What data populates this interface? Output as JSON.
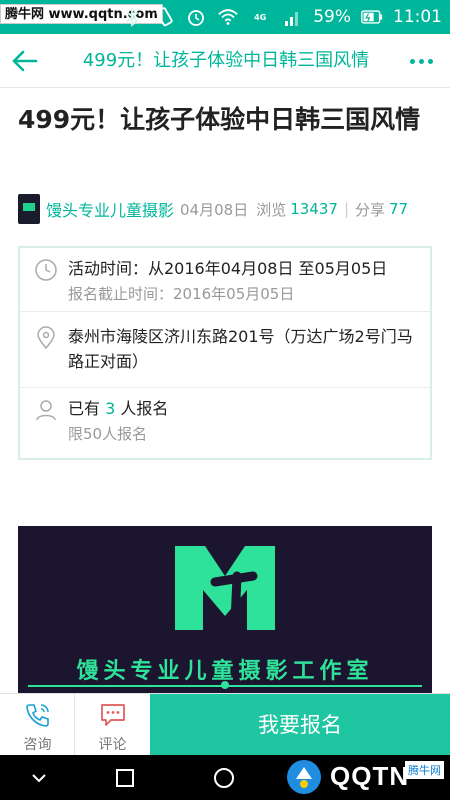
{
  "statusbar": {
    "watermark": "腾牛网 www.qqtn.com",
    "network_label": "4G",
    "battery_pct": "59%",
    "time": "11:01"
  },
  "nav": {
    "title": "499元！让孩子体验中日韩三国风情"
  },
  "article": {
    "title": "499元！让孩子体验中日韩三国风情",
    "author": "馒头专业儿童摄影",
    "date": "04月08日",
    "views_label": "浏览",
    "views": "13437",
    "separator": "|",
    "shares_label": "分享",
    "shares": "77"
  },
  "info": {
    "time_main": "活动时间：从2016年04月08日 至05月05日",
    "time_sub": "报名截止时间：2016年05月05日",
    "address": "泰州市海陵区济川东路201号（万达广场2号门马路正对面）",
    "signup_prefix": "已有",
    "signup_count": "3",
    "signup_suffix": "人报名",
    "signup_limit": "限50人报名"
  },
  "banner": {
    "text": "馒头专业儿童摄影工作室"
  },
  "actions": {
    "consult": "咨询",
    "comment": "评论",
    "signup": "我要报名"
  },
  "sysnav": {
    "watermark": "QQTN",
    "watermark_sub": "腾牛网"
  },
  "colors": {
    "accent": "#00b69a",
    "signup_button": "#1fc6a2",
    "banner_bg": "#1c1530",
    "banner_green": "#2fe29a"
  }
}
